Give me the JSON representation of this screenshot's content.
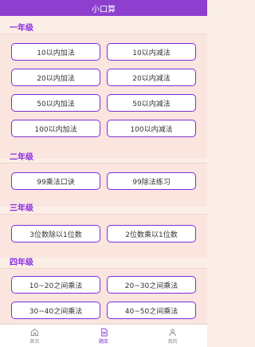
{
  "app": {
    "title": "小口算"
  },
  "sections": [
    {
      "title": "一年级",
      "buttons": [
        "10以内加法",
        "10以内减法",
        "20以内加法",
        "20以内减法",
        "50以内加法",
        "50以内减法",
        "100以内加法",
        "100以内减法"
      ]
    },
    {
      "title": "二年级",
      "buttons": [
        "99乘法口诀",
        "99除法练习"
      ]
    },
    {
      "title": "三年级",
      "buttons": [
        "3位数除以1位数",
        "2位数乘以1位数"
      ]
    },
    {
      "title": "四年级",
      "buttons": [
        "10~20之间乘法",
        "20~30之间乘法",
        "30~40之间乘法",
        "40~50之间乘法"
      ]
    }
  ],
  "tabbar": {
    "items": [
      {
        "label": "首页",
        "icon": "home-icon",
        "active": false
      },
      {
        "label": "题库",
        "icon": "document-icon",
        "active": true
      },
      {
        "label": "我的",
        "icon": "user-icon",
        "active": false
      }
    ]
  },
  "colors": {
    "header": "#8e3fd0",
    "accent": "#7b2fd6",
    "background": "#fbeee6"
  }
}
